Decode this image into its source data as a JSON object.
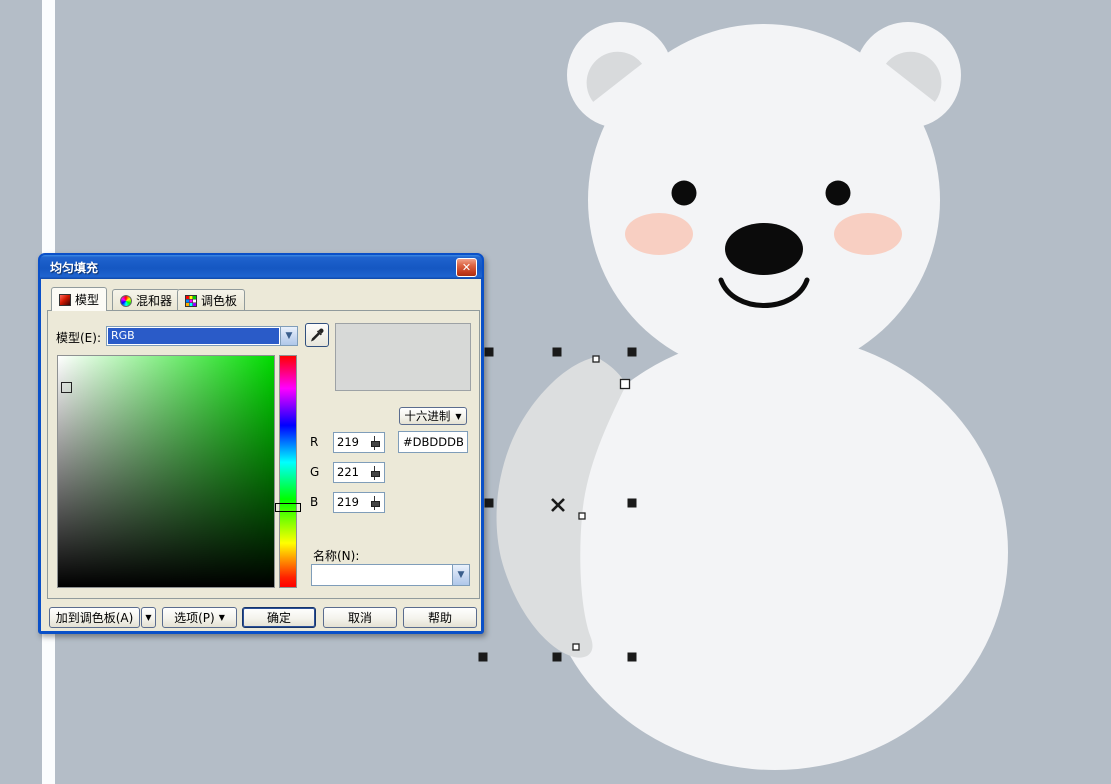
{
  "canvas": {
    "background_color": "#B4BDC7",
    "page_edge_color": "#FBFDFE",
    "bear": {
      "body_color": "#F3F4F6",
      "inner_ear_color": "#D8DADC",
      "eye_color": "#0B0B0B",
      "nose_color": "#0B0B0B",
      "mouth_color": "#0B0B0B",
      "cheek_color": "#F8CFC2",
      "selected_arm_color": "#DCDEDF"
    },
    "selection": {
      "handle_color": "#1A1A1A",
      "node_color": "#FFFFFF"
    }
  },
  "dialog": {
    "title": "均匀填充",
    "tabs": [
      {
        "label": "模型"
      },
      {
        "label": "混和器"
      },
      {
        "label": "调色板"
      }
    ],
    "model_label": "模型(E):",
    "model_value": "RGB",
    "preview_color": "#D7D9D7",
    "hex_button_label": "十六进制",
    "channels": [
      {
        "label": "R",
        "value": "219"
      },
      {
        "label": "G",
        "value": "221"
      },
      {
        "label": "B",
        "value": "219"
      }
    ],
    "hex_value": "#DBDDDB",
    "name_label": "名称(N):",
    "name_value": "",
    "buttons": {
      "add_to_palette": "加到调色板(A)",
      "options": "选项(P)",
      "ok": "确定",
      "cancel": "取消",
      "help": "帮助"
    },
    "icons": {
      "close": "✕",
      "dropdown": "▼",
      "combo_arrow": "▼"
    }
  }
}
